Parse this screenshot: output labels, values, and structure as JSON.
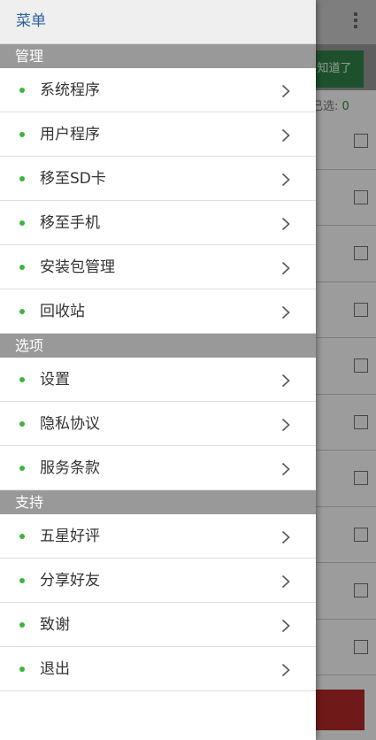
{
  "drawer": {
    "title": "菜单",
    "sections": [
      {
        "label": "管理",
        "items": [
          {
            "label": "系统程序"
          },
          {
            "label": "用户程序"
          },
          {
            "label": "移至SD卡"
          },
          {
            "label": "移至手机"
          },
          {
            "label": "安装包管理"
          },
          {
            "label": "回收站"
          }
        ]
      },
      {
        "label": "选项",
        "items": [
          {
            "label": "设置"
          },
          {
            "label": "隐私协议"
          },
          {
            "label": "服务条款"
          }
        ]
      },
      {
        "label": "支持",
        "items": [
          {
            "label": "五星好评"
          },
          {
            "label": "分享好友"
          },
          {
            "label": "致谢"
          },
          {
            "label": "退出"
          }
        ]
      }
    ]
  },
  "background": {
    "known_button": "知道了",
    "selected_label": "已选: ",
    "selected_count": "0"
  },
  "colors": {
    "accent_dot": "#3db53d",
    "title": "#2e5f9e",
    "section_bg": "#999999",
    "known_button_bg": "#2c7a44",
    "bottom_button_bg": "#a82626"
  },
  "icons": {
    "item_arrow": "chevron-right-icon",
    "overflow": "more-vertical-icon"
  }
}
